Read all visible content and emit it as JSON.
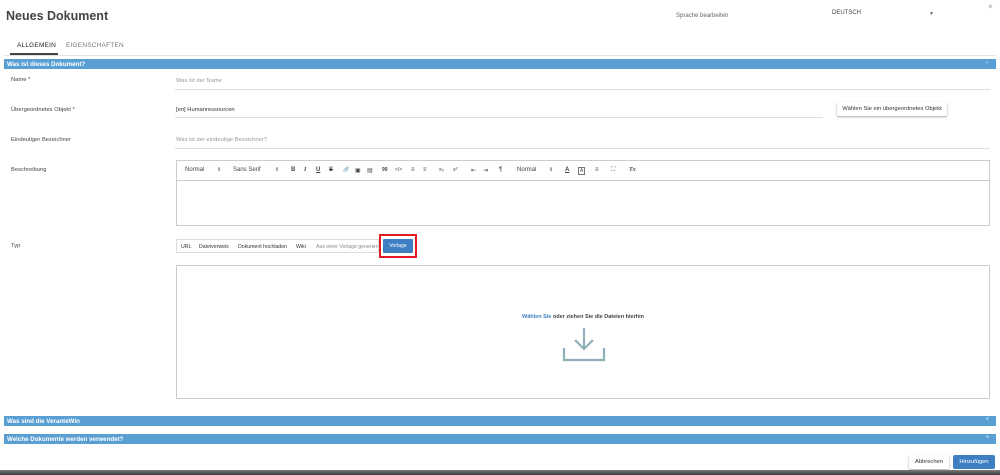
{
  "header": {
    "title": "Neues Dokument",
    "language_label": "Sprache bearbeiten",
    "language_value": "DEUTSCH",
    "close": "×"
  },
  "tabs": [
    {
      "label": "ALLGEMEIN",
      "active": true
    },
    {
      "label": "EIGENSCHAFTEN",
      "active": false
    }
  ],
  "sections": {
    "what": {
      "title": "Was ist dieses Dokument?",
      "toggle": "−"
    },
    "responsible": {
      "title": "Was sind die VeranteWin",
      "toggle": "+"
    },
    "documents": {
      "title": "Welche Dokumente werden verwendet?",
      "toggle": "+"
    }
  },
  "form": {
    "name": {
      "label": "Name *",
      "placeholder": "Was ist der Name"
    },
    "parent": {
      "label": "Übergeordnetes Objekt *",
      "value": "[en] Humanressourcen",
      "button": "Wählen Sie ein übergeordnetes Objekt"
    },
    "identifier": {
      "label": "Eindeutiger Bezeichner",
      "placeholder": "Was ist der eindeutige Bezeichner?"
    },
    "description": {
      "label": "Beschreibung"
    },
    "type": {
      "label": "Typ"
    }
  },
  "editor_toolbar": {
    "heading": "Normal",
    "font": "Sans Serif",
    "size": "Normal",
    "select_caret": "⇕",
    "bold": "B",
    "italic": "I",
    "underline": "U",
    "strike": "S",
    "link": "🔗",
    "image": "▣",
    "video": "▤",
    "quote": "99",
    "code": "</>",
    "ol": "≡",
    "ul": "≡",
    "sub": "x₂",
    "sup": "x²",
    "indent_less": "⇤",
    "indent_more": "⇥",
    "rtl": "¶",
    "color": "A",
    "bg": "A",
    "align": "≡",
    "fullscreen": "⛶",
    "clean": "Tx"
  },
  "type_options": [
    "URL",
    "Dateiverweis",
    "Dokument hochladen",
    "Wiki",
    "Aus einer Vorlage generieren"
  ],
  "type_active": "Vorlage",
  "dropzone": {
    "link": "Wählen Sie",
    "text": " oder ziehen Sie die Dateien hierhin"
  },
  "footer": {
    "cancel": "Abbrechen",
    "add": "Hinzufügen"
  },
  "colors": {
    "accent": "#5a9fd4",
    "primary_button": "#3d7fc2",
    "highlight": "#e01b24"
  }
}
